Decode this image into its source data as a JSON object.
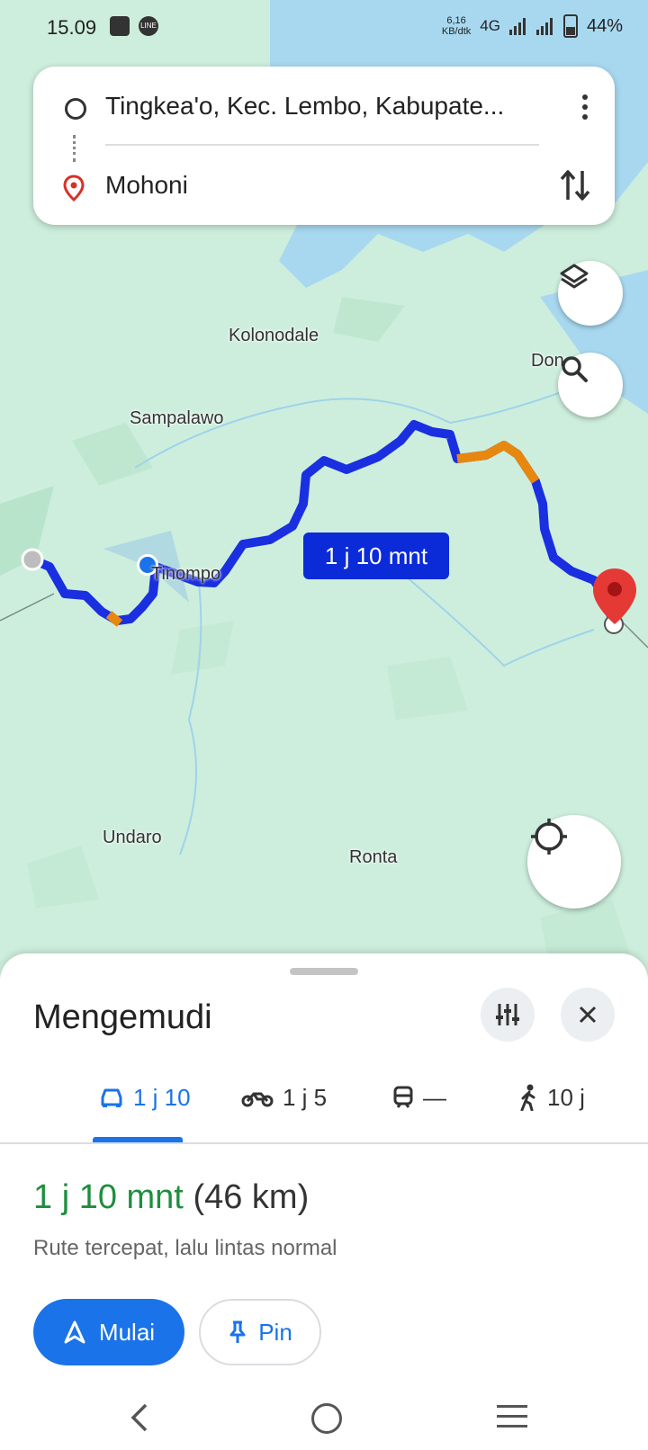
{
  "status_bar": {
    "time": "15.09",
    "net_speed_value": "6,16",
    "net_speed_unit": "KB/dtk",
    "network": "4G",
    "battery": "44%"
  },
  "route": {
    "origin": "Tingkea'o, Kec. Lembo, Kabupate...",
    "destination": "Mohoni"
  },
  "map": {
    "places": {
      "kolonodale": "Kolonodale",
      "sampalawo": "Sampalawo",
      "don": "Don",
      "tinompo": "Tinompo",
      "undaro": "Undaro",
      "ronta": "Ronta"
    },
    "route_duration_label": "1 j 10 mnt",
    "colors": {
      "route": "#1a2fe0",
      "traffic_slow": "#e8870e",
      "water": "#a8d8f0",
      "land": "#cdeedd",
      "destination_pin": "#d93025"
    }
  },
  "sheet": {
    "title": "Mengemudi",
    "modes": [
      {
        "icon": "car-icon",
        "label": "1 j 10",
        "active": true
      },
      {
        "icon": "motorcycle-icon",
        "label": "1 j 5",
        "active": false
      },
      {
        "icon": "train-icon",
        "label": "—",
        "active": false
      },
      {
        "icon": "walk-icon",
        "label": "10 j",
        "active": false
      }
    ],
    "summary_time": "1 j 10 mnt",
    "summary_distance": "(46 km)",
    "summary_note": "Rute tercepat, lalu lintas normal",
    "start_label": "Mulai",
    "pin_label": "Pin"
  }
}
